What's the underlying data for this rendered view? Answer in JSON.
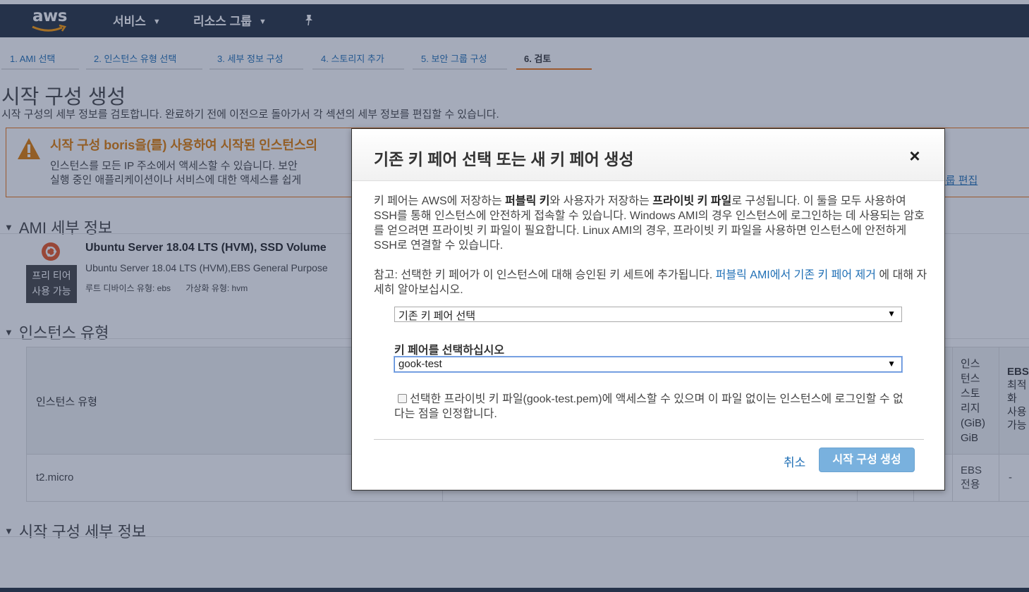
{
  "topnav": {
    "logo_text": "aws",
    "services_label": "서비스",
    "resource_groups_label": "리소스 그룹",
    "chevron": "⌄"
  },
  "wizard": {
    "steps": [
      {
        "label": "1. AMI 선택"
      },
      {
        "label": "2. 인스턴스 유형 선택"
      },
      {
        "label": "3. 세부 정보 구성"
      },
      {
        "label": "4. 스토리지 추가"
      },
      {
        "label": "5. 보안 그룹 구성"
      },
      {
        "label": "6. 검토"
      }
    ]
  },
  "page": {
    "title": "시작 구성 생성",
    "description": "시작 구성의 세부 정보를 검토합니다. 완료하기 전에 이전으로 돌아가서 각 섹션의 세부 정보를 편집할 수 있습니다."
  },
  "warning": {
    "title": "시작 구성 boris을(를) 사용하여 시작된 인스턴스의",
    "line1": "인스턴스를 모든 IP 주소에서 액세스할 수 있습니다. 보안",
    "line2": "실행 중인 애플리케이션이나 서비스에 대한 액세스를 쉽게",
    "edit_link": "안 그룹 편집"
  },
  "ami_section": {
    "heading": "AMI 세부 정보",
    "badge_line1": "프리 티어",
    "badge_line2": "사용 가능",
    "name": "Ubuntu Server 18.04 LTS (HVM), SSD Volume",
    "description": "Ubuntu Server 18.04 LTS (HVM),EBS General Purpose",
    "root_device": "루트 디바이스 유형: ebs",
    "virtualization": "가상화 유형: hvm"
  },
  "instance_section": {
    "heading": "인스턴스 유형",
    "col_type": "인스턴스 유형",
    "col_storage": [
      "인스",
      "턴스",
      "스토",
      "리지",
      "(GiB)",
      "GiB"
    ],
    "col_ebs": [
      "EBS",
      "최적",
      "화",
      "사용",
      "가능"
    ],
    "row_type": "t2.micro",
    "row_storage": [
      "EBS",
      "전용"
    ],
    "row_ebs": "-"
  },
  "launch_section": {
    "heading": "시작 구성 세부 정보"
  },
  "modal": {
    "title": "기존 키 페어 선택 또는 새 키 페어 생성",
    "close": "×",
    "p1_a": "키 페어는 AWS에 저장하는 ",
    "p1_b": "퍼블릭 키",
    "p1_c": "와 사용자가 저장하는 ",
    "p1_d": "프라이빗 키 파일",
    "p1_e": "로 구성됩니다. 이 둘을 모두 사용하여 SSH를 통해 인스턴스에 안전하게 접속할 수 있습니다. Windows AMI의 경우 인스턴스에 로그인하는 데 사용되는 암호를 얻으려면 프라이빗 키 파일이 필요합니다. Linux AMI의 경우, 프라이빗 키 파일을 사용하면 인스턴스에 안전하게 SSH로 연결할 수 있습니다.",
    "p2_a": "참고: 선택한 키 페어가 이 인스턴스에 대해 승인된 키 세트에 추가됩니다. ",
    "p2_link": "퍼블릭 AMI에서 기존 키 페어 제거",
    "p2_b": " 에 대해 자세히 알아보십시오.",
    "mode_select": "기존 키 페어 선택",
    "keypair_label": "키 페어를 선택하십시오",
    "keypair_select": "gook-test",
    "select_arrow": "▼",
    "ack_text": "선택한 프라이빗 키 파일(gook-test.pem)에 액세스할 수 있으며 이 파일 없이는 인스턴스에 로그인할 수 없다는 점을 인정합니다.",
    "cancel_label": "취소",
    "create_label": "시작 구성 생성"
  },
  "colors": {
    "nav_bg": "#232f3e",
    "accent_orange": "#ec7211",
    "link_blue": "#1f6fb5",
    "primary_button": "#79b1de"
  }
}
